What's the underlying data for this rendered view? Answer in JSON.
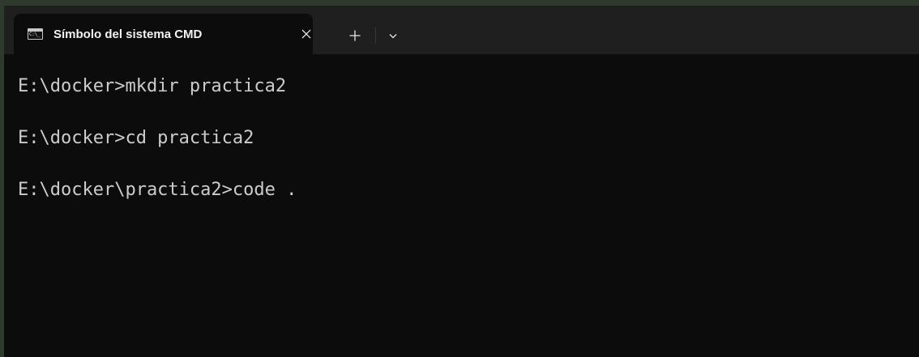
{
  "tab": {
    "icon": "cmd-icon",
    "title": "Símbolo del sistema CMD"
  },
  "titlebar": {
    "close_icon": "close-icon",
    "new_tab_icon": "plus-icon",
    "dropdown_icon": "chevron-down-icon"
  },
  "terminal": {
    "lines": [
      "E:\\docker>mkdir practica2",
      "E:\\docker>cd practica2",
      "E:\\docker\\practica2>code ."
    ]
  },
  "colors": {
    "background": "#0c0c0c",
    "titlebar": "#1f1f1f",
    "text": "#cccccc",
    "border_accent": "#2e3b2c"
  }
}
